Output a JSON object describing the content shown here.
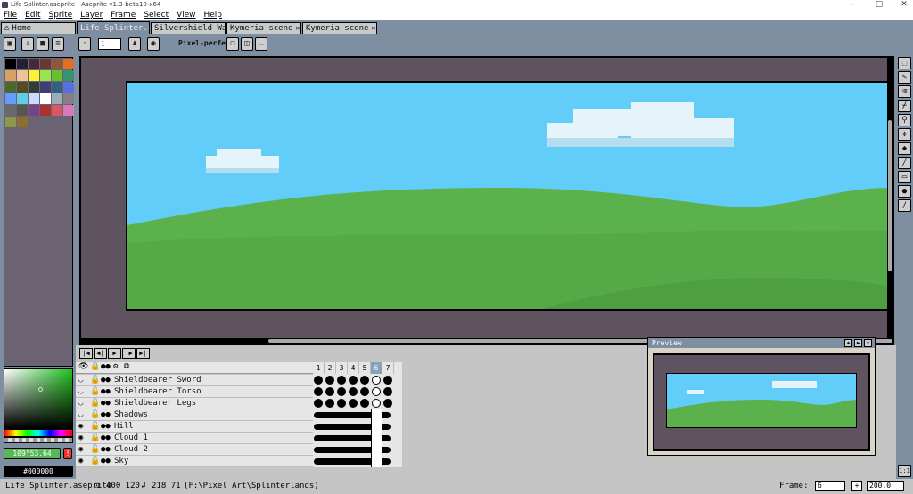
{
  "window": {
    "title": "Life Splinter.aseprite - Aseprite v1.3-beta10-x64",
    "minimize": "–",
    "maximize": "▢",
    "close": "✕"
  },
  "menu": [
    "File",
    "Edit",
    "Sprite",
    "Layer",
    "Frame",
    "Select",
    "View",
    "Help"
  ],
  "tabs": [
    {
      "label": "Home",
      "icon": "home-icon",
      "active": false,
      "closable": false
    },
    {
      "label": "Life Splinter.as",
      "active": true,
      "closable": true
    },
    {
      "label": "Silvershield Wa",
      "active": false,
      "closable": true
    },
    {
      "label": "Kymeria scene",
      "active": false,
      "closable": true
    },
    {
      "label": "Kymeria scene",
      "active": false,
      "closable": true
    }
  ],
  "toolbar": {
    "brush_size": "1",
    "pixel_perfect_label": "Pixel-perfect"
  },
  "palette_colors": [
    "#000000",
    "#222034",
    "#45283c",
    "#663931",
    "#8f563b",
    "#df7126",
    "#d9a066",
    "#eec39a",
    "#fbf236",
    "#99e550",
    "#6abe30",
    "#37946e",
    "#4b692f",
    "#524b24",
    "#323c39",
    "#3f3f74",
    "#306082",
    "#5b6ee1",
    "#639bff",
    "#5fcde4",
    "#cbdbfc",
    "#ffffff",
    "#9badb7",
    "#847e87",
    "#696a6a",
    "#595652",
    "#76428a",
    "#ac3232",
    "#d95763",
    "#d77bba",
    "#8f974a",
    "#8a6f30"
  ],
  "color": {
    "foreground_label": "109°53.64",
    "background_label": "#000000",
    "fg_hex": "#56b857",
    "bg_hex": "#000000"
  },
  "layers": [
    {
      "name": "Shieldbearer Sword",
      "visible": false
    },
    {
      "name": "Shieldbearer Torso",
      "visible": false
    },
    {
      "name": "Shieldbearer Legs",
      "visible": false
    },
    {
      "name": "Shadows",
      "visible": false
    },
    {
      "name": "Hill",
      "visible": true
    },
    {
      "name": "Cloud 1",
      "visible": true
    },
    {
      "name": "Cloud 2",
      "visible": true
    },
    {
      "name": "Sky",
      "visible": true
    }
  ],
  "frames": [
    "1",
    "2",
    "3",
    "4",
    "5",
    "6",
    "7"
  ],
  "current_frame_index": 5,
  "preview": {
    "title": "Preview"
  },
  "status": {
    "file": "Life Splinter.aseprite",
    "size": "400 120",
    "position": "218 71",
    "path": "(F:\\Pixel Art\\Splinterlands)",
    "frame_label": "Frame:",
    "frame_value": "6",
    "zoom": "200.0",
    "zoom_reset": "1:1"
  }
}
